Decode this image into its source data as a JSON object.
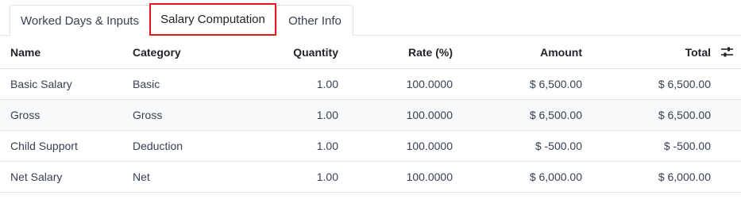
{
  "tabs": [
    {
      "label": "Worked Days & Inputs"
    },
    {
      "label": "Salary Computation"
    },
    {
      "label": "Other Info"
    }
  ],
  "active_tab": "Salary Computation",
  "table": {
    "headers": {
      "name": "Name",
      "category": "Category",
      "quantity": "Quantity",
      "rate": "Rate (%)",
      "amount": "Amount",
      "total": "Total"
    },
    "settings_icon": "sliders-icon",
    "rows": [
      {
        "name": "Basic Salary",
        "category": "Basic",
        "quantity": "1.00",
        "rate": "100.0000",
        "amount": "$ 6,500.00",
        "total": "$ 6,500.00"
      },
      {
        "name": "Gross",
        "category": "Gross",
        "quantity": "1.00",
        "rate": "100.0000",
        "amount": "$ 6,500.00",
        "total": "$ 6,500.00"
      },
      {
        "name": "Child Support",
        "category": "Deduction",
        "quantity": "1.00",
        "rate": "100.0000",
        "amount": "$ -500.00",
        "total": "$ -500.00"
      },
      {
        "name": "Net Salary",
        "category": "Net",
        "quantity": "1.00",
        "rate": "100.0000",
        "amount": "$ 6,000.00",
        "total": "$ 6,000.00"
      }
    ]
  },
  "colors": {
    "highlight": "#e3141c",
    "border": "#dee2e6",
    "stripe": "#f8f9fa"
  }
}
